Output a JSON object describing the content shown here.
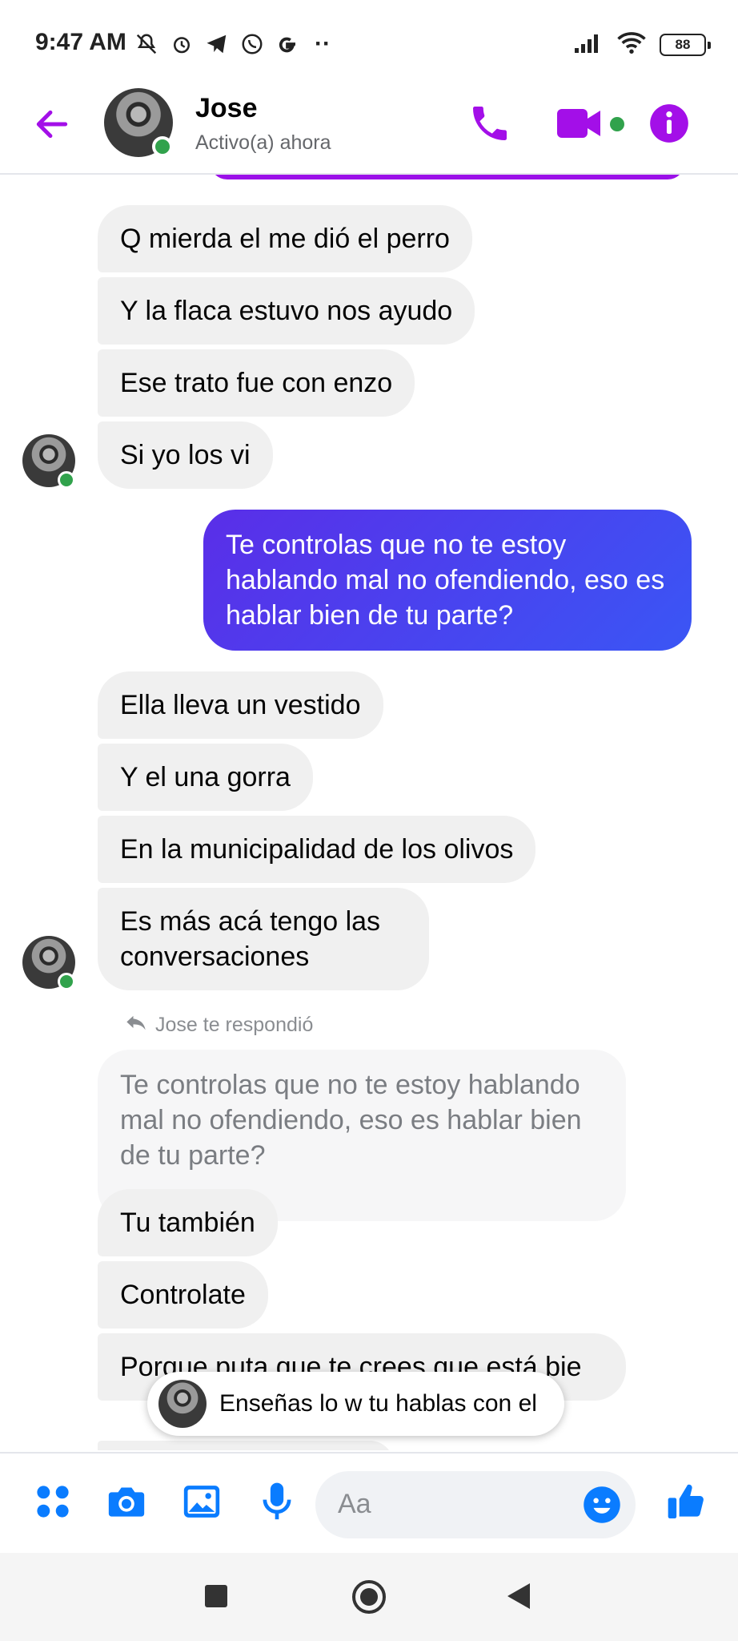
{
  "status_bar": {
    "time": "9:47 AM",
    "extra": "··",
    "battery": "88"
  },
  "header": {
    "name": "Jose",
    "status": "Activo(a) ahora"
  },
  "messages": [
    {
      "text": "Q mierda el me dió el perro"
    },
    {
      "text": "Y la flaca estuvo nos ayudo"
    },
    {
      "text": "Ese trato fue con enzo"
    },
    {
      "text": "Si yo los vi"
    },
    {
      "text": "Te controlas que no te estoy hablando mal no ofendiendo, eso es hablar bien de tu parte?"
    },
    {
      "text": "Ella lleva un vestido"
    },
    {
      "text": "Y el una gorra"
    },
    {
      "text": "En la municipalidad de los olivos"
    },
    {
      "text": "Es más acá tengo las conversaciones"
    },
    {
      "text": "Tu también"
    },
    {
      "text": "Controlate"
    },
    {
      "text": "Porque puta que te crees que está bie"
    }
  ],
  "reply": {
    "label": "Jose te respondió",
    "quote": "Te controlas que no te estoy hablando mal no ofendiendo, eso es hablar bien de tu parte?"
  },
  "preview": {
    "text": "Enseñas lo w tu hablas con el"
  },
  "composer": {
    "placeholder": "Aa"
  },
  "colors": {
    "accent_purple": "#a30fe8",
    "messenger_blue": "#0a7cff",
    "online_green": "#31a24c",
    "outgoing_gradient_start": "#5a2ee8",
    "outgoing_gradient_end": "#3a56f5"
  },
  "icons": {
    "back": "arrow-left-icon",
    "call": "phone-icon",
    "video": "video-camera-icon",
    "info": "info-icon",
    "apps": "four-dots-icon",
    "camera": "camera-icon",
    "gallery": "image-icon",
    "mic": "microphone-icon",
    "emoji": "smiley-icon",
    "like": "thumbs-up-icon"
  }
}
